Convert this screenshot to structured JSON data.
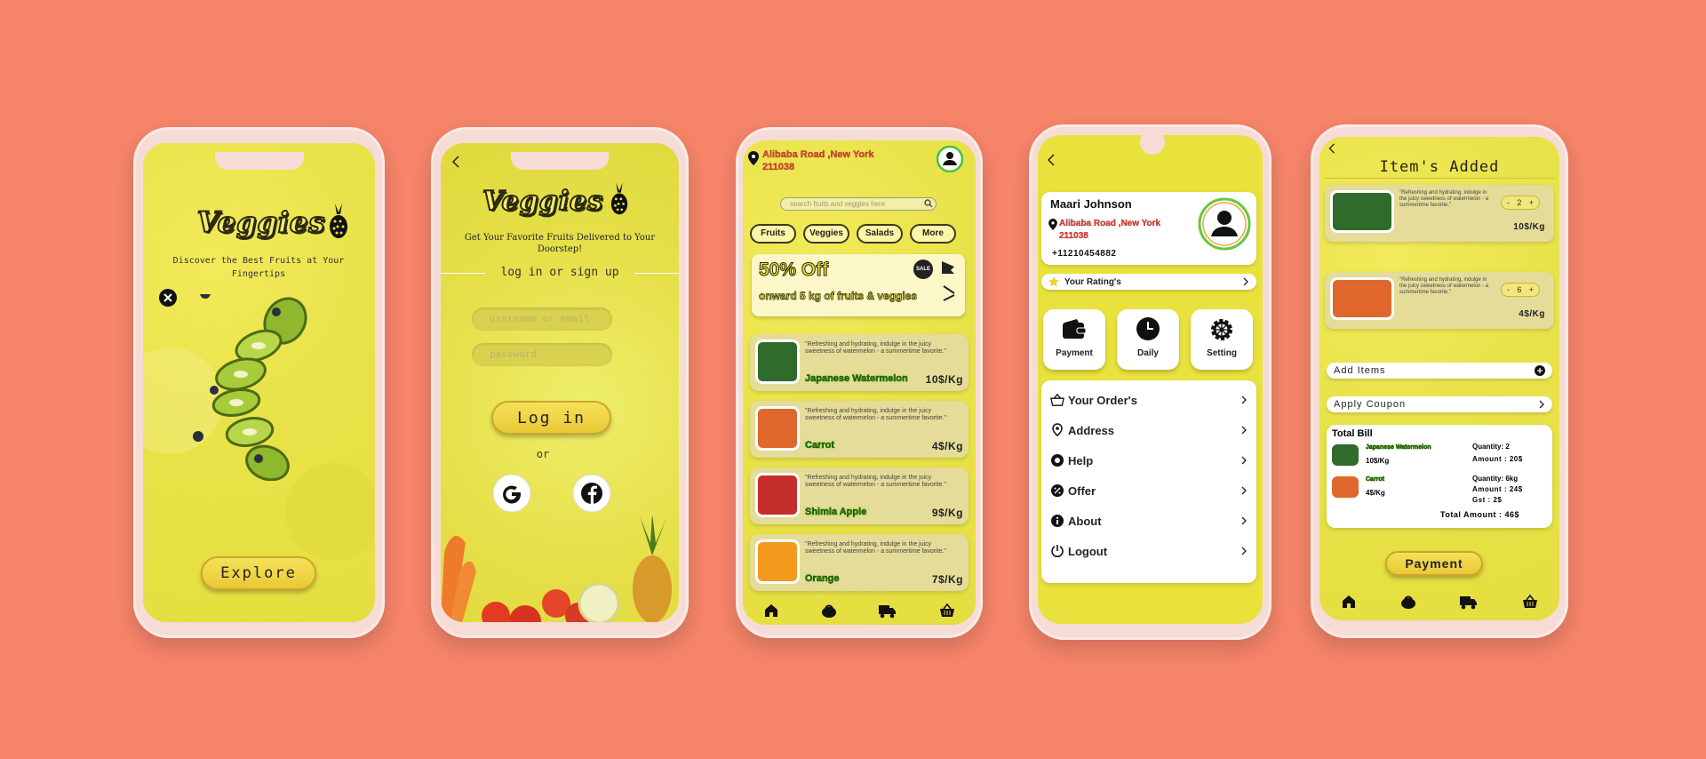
{
  "screen1": {
    "logo": "Veggies",
    "tagline": "Discover the Best Fruits at Your Fingertips",
    "explore_label": "Explore"
  },
  "screen2": {
    "logo": "Veggies",
    "subtitle": "Get Your Favorite Fruits Delivered to Your Doorstep!",
    "divider_text": "log in or sign up",
    "username_placeholder": "username or email",
    "password_placeholder": "password",
    "login_label": "Log in",
    "or_text": "or"
  },
  "screen3": {
    "address_line1": "Alibaba Road ,New York",
    "address_line2": "211038",
    "search_placeholder": "search fruits and veggies here",
    "categories": [
      "Fruits",
      "Veggies",
      "Salads",
      "More"
    ],
    "banner_title": "50% Off",
    "banner_sub": "onward 5 kg of fruits & veggies",
    "banner_badge": "SALE",
    "products": [
      {
        "name": "Japanese Watermelon",
        "price": "10$/Kg",
        "desc": "\"Refreshing and hydrating, indulge in the juicy sweetness of watermelon - a summertime favorite.\"",
        "color": "#2f6b2a"
      },
      {
        "name": "Carrot",
        "price": "4$/Kg",
        "desc": "\"Refreshing and hydrating, indulge in the juicy sweetness of watermelon - a summertime favorite.\"",
        "color": "#e0672b"
      },
      {
        "name": "Shimla Apple",
        "price": "9$/Kg",
        "desc": "\"Refreshing and hydrating, indulge in the juicy sweetness of watermelon - a summertime favorite.\"",
        "color": "#c62e2b"
      },
      {
        "name": "Orange",
        "price": "7$/Kg",
        "desc": "\"Refreshing and hydrating, indulge in the juicy sweetness of watermelon - a summertime favorite.\"",
        "color": "#f39a1c"
      }
    ]
  },
  "screen4": {
    "user_name": "Maari Johnson",
    "address_line1": "Alibaba Road ,New York",
    "address_line2": "211038",
    "phone": "+11210454882",
    "rating_label": "Your Rating's",
    "tiles": [
      "Payment",
      "Daily",
      "Setting"
    ],
    "menu": [
      "Your Order's",
      "Address",
      "Help",
      "Offer",
      "About",
      "Logout"
    ]
  },
  "screen5": {
    "title": "Item's Added",
    "items": [
      {
        "desc": "\"Refreshing and hydrating, indulge in the juicy sweetness of watermelon - a summertime favorite.\"",
        "qty": "2",
        "price": "10$/Kg",
        "color": "#2f6b2a"
      },
      {
        "desc": "\"Refreshing and hydrating, indulge in the juicy sweetness of watermelon - a summertime favorite.\"",
        "qty": "6",
        "price": "4$/Kg",
        "color": "#e0672b"
      }
    ],
    "add_items_label": "Add Items",
    "apply_coupon_label": "Apply Coupon",
    "bill_title": "Total Bill",
    "bill": [
      {
        "name": "Japanese Watermelon",
        "price": "10$/Kg",
        "quantity": "Quantity: 2",
        "amount": "Amount : 20$"
      },
      {
        "name": "Carrot",
        "price": "4$/Kg",
        "quantity": "Quantity: 6kg",
        "amount": "Amount : 24$",
        "gst": "Gst : 2$"
      }
    ],
    "total": "Total Amount : 46$",
    "payment_label": "Payment"
  }
}
